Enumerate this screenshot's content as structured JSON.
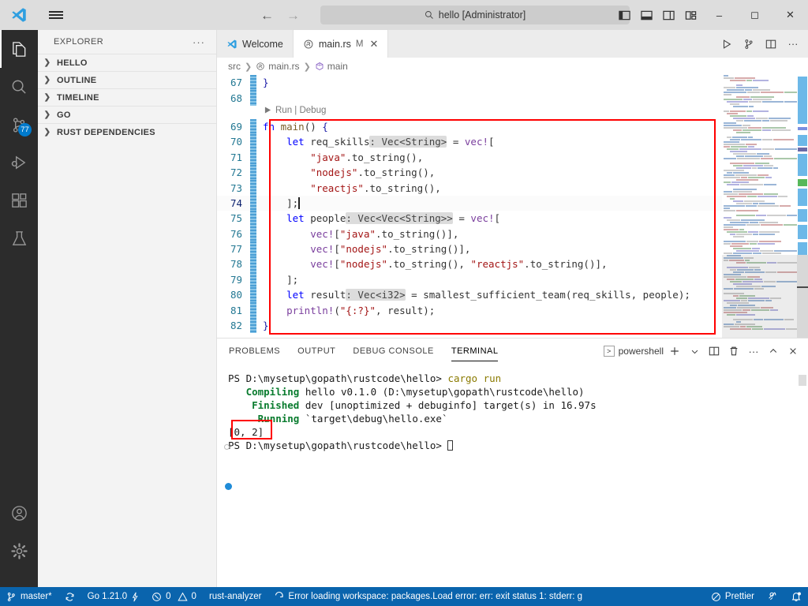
{
  "titlebar": {
    "search_value": "hello [Administrator]",
    "back_label": "←",
    "forward_label": "→",
    "minimize_label": "–",
    "maximize_label": "◻",
    "close_label": "✕",
    "layout_icons": [
      "toggle-primary-sidebar-icon",
      "toggle-panel-icon",
      "toggle-secondary-sidebar-icon",
      "customize-layout-icon"
    ]
  },
  "activitybar": {
    "items": [
      {
        "name": "explorer",
        "active": true,
        "badge": ""
      },
      {
        "name": "search",
        "active": false,
        "badge": ""
      },
      {
        "name": "source-control",
        "active": false,
        "badge": "77"
      },
      {
        "name": "run-and-debug",
        "active": false,
        "badge": ""
      },
      {
        "name": "extensions",
        "active": false,
        "badge": ""
      },
      {
        "name": "testing",
        "active": false,
        "badge": ""
      }
    ],
    "bottom": [
      {
        "name": "accounts"
      },
      {
        "name": "manage-settings"
      }
    ]
  },
  "sidebar": {
    "title": "EXPLORER",
    "more_actions": "···",
    "sections": [
      {
        "label": "HELLO",
        "expanded": false
      },
      {
        "label": "OUTLINE",
        "expanded": false
      },
      {
        "label": "TIMELINE",
        "expanded": false
      },
      {
        "label": "GO",
        "expanded": false
      },
      {
        "label": "RUST DEPENDENCIES",
        "expanded": false
      }
    ]
  },
  "editor": {
    "tabs": [
      {
        "label": "Welcome",
        "active": false,
        "modified": "",
        "icon": "vscode-logo-icon"
      },
      {
        "label": "main.rs",
        "active": true,
        "modified": "M",
        "icon": "rust-file-icon",
        "close": "✕"
      }
    ],
    "tab_actions": [
      "run-file-icon",
      "run-debug-icon",
      "split-editor-icon",
      "more-actions-icon"
    ],
    "breadcrumb": [
      "src",
      "main.rs",
      "main"
    ],
    "codelens": "Run | Debug",
    "lines": [
      {
        "n": "67",
        "indent": 0,
        "tokens": [
          {
            "t": "}",
            "c": "kw2"
          }
        ]
      },
      {
        "n": "68",
        "indent": 0,
        "tokens": []
      },
      {
        "n": "69",
        "indent": 0,
        "tokens": [
          {
            "t": "fn ",
            "c": "kw"
          },
          {
            "t": "main",
            "c": "fn"
          },
          {
            "t": "() ",
            "c": "punc"
          },
          {
            "t": "{",
            "c": "kw2"
          }
        ]
      },
      {
        "n": "70",
        "indent": 1,
        "tokens": [
          {
            "t": "let ",
            "c": "kw"
          },
          {
            "t": "req_skills",
            "c": "punc"
          },
          {
            "t": ": Vec<String>",
            "c": "typehint"
          },
          {
            "t": " = ",
            "c": "punc"
          },
          {
            "t": "vec!",
            "c": "macro"
          },
          {
            "t": "[",
            "c": "punc"
          }
        ]
      },
      {
        "n": "71",
        "indent": 2,
        "tokens": [
          {
            "t": "\"java\"",
            "c": "str"
          },
          {
            "t": ".to_string()",
            "c": "punc"
          },
          {
            "t": ",",
            "c": "punc"
          }
        ]
      },
      {
        "n": "72",
        "indent": 2,
        "tokens": [
          {
            "t": "\"nodejs\"",
            "c": "str"
          },
          {
            "t": ".to_string()",
            "c": "punc"
          },
          {
            "t": ",",
            "c": "punc"
          }
        ]
      },
      {
        "n": "73",
        "indent": 2,
        "tokens": [
          {
            "t": "\"reactjs\"",
            "c": "str"
          },
          {
            "t": ".to_string()",
            "c": "punc"
          },
          {
            "t": ",",
            "c": "punc"
          }
        ]
      },
      {
        "n": "74",
        "indent": 1,
        "tokens": [
          {
            "t": "];",
            "c": "punc"
          }
        ],
        "current": true
      },
      {
        "n": "75",
        "indent": 1,
        "tokens": [
          {
            "t": "let ",
            "c": "kw"
          },
          {
            "t": "people",
            "c": "punc"
          },
          {
            "t": ": Vec<Vec<String>>",
            "c": "typehint"
          },
          {
            "t": " = ",
            "c": "punc"
          },
          {
            "t": "vec!",
            "c": "macro"
          },
          {
            "t": "[",
            "c": "punc"
          }
        ]
      },
      {
        "n": "76",
        "indent": 2,
        "tokens": [
          {
            "t": "vec!",
            "c": "macro"
          },
          {
            "t": "[",
            "c": "punc"
          },
          {
            "t": "\"java\"",
            "c": "str"
          },
          {
            "t": ".to_string()],",
            "c": "punc"
          }
        ]
      },
      {
        "n": "77",
        "indent": 2,
        "tokens": [
          {
            "t": "vec!",
            "c": "macro"
          },
          {
            "t": "[",
            "c": "punc"
          },
          {
            "t": "\"nodejs\"",
            "c": "str"
          },
          {
            "t": ".to_string()],",
            "c": "punc"
          }
        ]
      },
      {
        "n": "78",
        "indent": 2,
        "tokens": [
          {
            "t": "vec!",
            "c": "macro"
          },
          {
            "t": "[",
            "c": "punc"
          },
          {
            "t": "\"nodejs\"",
            "c": "str"
          },
          {
            "t": ".to_string(), ",
            "c": "punc"
          },
          {
            "t": "\"reactjs\"",
            "c": "str"
          },
          {
            "t": ".to_string()],",
            "c": "punc"
          }
        ]
      },
      {
        "n": "79",
        "indent": 1,
        "tokens": [
          {
            "t": "];",
            "c": "punc"
          }
        ]
      },
      {
        "n": "80",
        "indent": 1,
        "tokens": [
          {
            "t": "let ",
            "c": "kw"
          },
          {
            "t": "result",
            "c": "punc"
          },
          {
            "t": ": Vec<i32>",
            "c": "typehint"
          },
          {
            "t": " = ",
            "c": "punc"
          },
          {
            "t": "smallest_sufficient_team",
            "c": "punc"
          },
          {
            "t": "(req_skills, people);",
            "c": "punc"
          }
        ]
      },
      {
        "n": "81",
        "indent": 1,
        "tokens": [
          {
            "t": "println!",
            "c": "macro"
          },
          {
            "t": "(",
            "c": "punc"
          },
          {
            "t": "\"{:?}\"",
            "c": "str"
          },
          {
            "t": ", result);",
            "c": "punc"
          }
        ]
      },
      {
        "n": "82",
        "indent": 0,
        "tokens": [
          {
            "t": "}",
            "c": "kw2"
          }
        ]
      }
    ],
    "annotation_color": "#ff0000"
  },
  "panel": {
    "tabs": [
      {
        "label": "PROBLEMS",
        "active": false
      },
      {
        "label": "OUTPUT",
        "active": false
      },
      {
        "label": "DEBUG CONSOLE",
        "active": false
      },
      {
        "label": "TERMINAL",
        "active": true
      }
    ],
    "terminal_name": "powershell",
    "actions": [
      "new-terminal-icon",
      "terminal-dropdown-icon",
      "split-terminal-icon",
      "kill-terminal-icon",
      "more-actions-icon",
      "maximize-panel-icon",
      "close-panel-icon"
    ],
    "terminal_lines": [
      [
        {
          "t": "PS D:\\mysetup\\gopath\\rustcode\\hello> ",
          "c": "t-plain"
        },
        {
          "t": "cargo run",
          "c": "t-yellow"
        }
      ],
      [
        {
          "t": "   ",
          "c": "t-plain"
        },
        {
          "t": "Compiling",
          "c": "t-green"
        },
        {
          "t": " hello v0.1.0 (D:\\mysetup\\gopath\\rustcode\\hello)",
          "c": "t-plain"
        }
      ],
      [
        {
          "t": "    ",
          "c": "t-plain"
        },
        {
          "t": "Finished",
          "c": "t-green"
        },
        {
          "t": " dev [unoptimized + debuginfo] target(s) in 16.97s",
          "c": "t-plain"
        }
      ],
      [
        {
          "t": "     ",
          "c": "t-plain"
        },
        {
          "t": "Running",
          "c": "t-green"
        },
        {
          "t": " `target\\debug\\hello.exe`",
          "c": "t-plain"
        }
      ],
      [
        {
          "t": "[0, 2]",
          "c": "t-plain"
        }
      ],
      [
        {
          "t": "PS D:\\mysetup\\gopath\\rustcode\\hello> ",
          "c": "t-plain"
        }
      ]
    ],
    "highlighted_output": "[0, 2]"
  },
  "statusbar": {
    "left": [
      {
        "name": "remote-branch",
        "icon": "source-control-icon",
        "label": "master*"
      },
      {
        "name": "sync-changes",
        "icon": "sync-icon",
        "label": ""
      },
      {
        "name": "go-version",
        "icon": "",
        "label": "Go 1.21.0",
        "trailing_icon": "zap-icon"
      },
      {
        "name": "problems",
        "icon": "error-icon",
        "label": "0",
        "icon2": "warning-icon",
        "label2": "0"
      },
      {
        "name": "rust-analyzer",
        "icon": "",
        "label": "rust-analyzer"
      },
      {
        "name": "workspace-error",
        "icon": "loading-icon",
        "label": "Error loading workspace: packages.Load error: err: exit status 1: stderr: g"
      }
    ],
    "right": [
      {
        "name": "prettier",
        "icon": "prettier-icon",
        "label": "Prettier"
      },
      {
        "name": "remote-indicator",
        "icon": "broadcast-icon",
        "label": ""
      },
      {
        "name": "notifications",
        "icon": "bell-dot-icon",
        "label": ""
      }
    ],
    "background": "#0a64ad"
  }
}
